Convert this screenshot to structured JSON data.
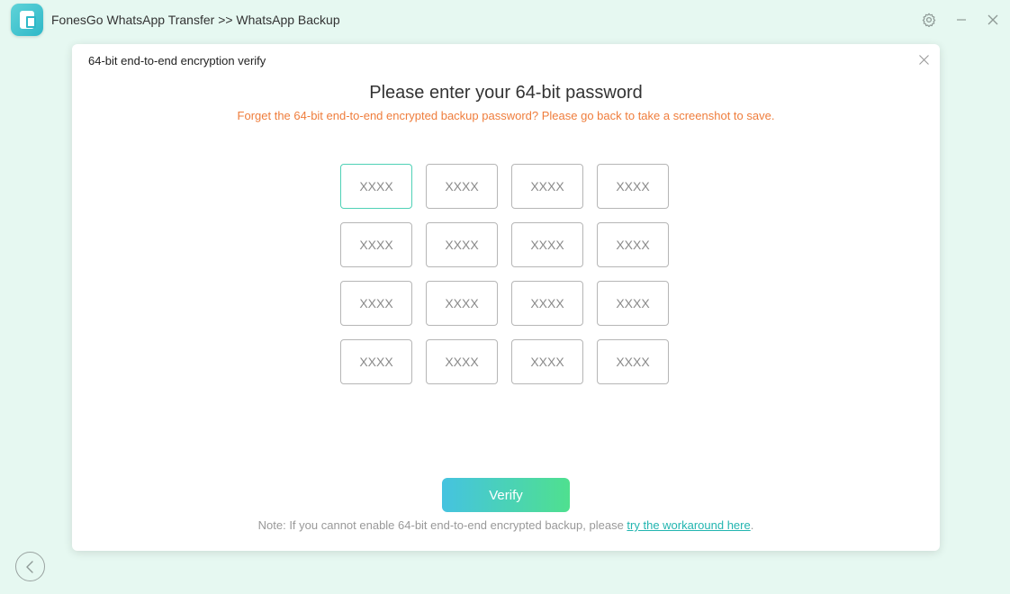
{
  "app": {
    "title": "FonesGo WhatsApp Transfer >> WhatsApp Backup",
    "icon": "app-logo-icon"
  },
  "window_controls": {
    "settings_icon": "gear-icon",
    "minimize_icon": "minimize-icon",
    "close_icon": "close-icon"
  },
  "dialog": {
    "title": "64-bit end-to-end encryption verify",
    "heading": "Please enter your 64-bit password",
    "subheading": "Forget the 64-bit end-to-end encrypted backup password? Please go back to take a screenshot to save.",
    "inputs": [
      {
        "placeholder": "XXXX",
        "value": ""
      },
      {
        "placeholder": "XXXX",
        "value": ""
      },
      {
        "placeholder": "XXXX",
        "value": ""
      },
      {
        "placeholder": "XXXX",
        "value": ""
      },
      {
        "placeholder": "XXXX",
        "value": ""
      },
      {
        "placeholder": "XXXX",
        "value": ""
      },
      {
        "placeholder": "XXXX",
        "value": ""
      },
      {
        "placeholder": "XXXX",
        "value": ""
      },
      {
        "placeholder": "XXXX",
        "value": ""
      },
      {
        "placeholder": "XXXX",
        "value": ""
      },
      {
        "placeholder": "XXXX",
        "value": ""
      },
      {
        "placeholder": "XXXX",
        "value": ""
      },
      {
        "placeholder": "XXXX",
        "value": ""
      },
      {
        "placeholder": "XXXX",
        "value": ""
      },
      {
        "placeholder": "XXXX",
        "value": ""
      },
      {
        "placeholder": "XXXX",
        "value": ""
      }
    ],
    "verify_label": "Verify",
    "note_text": "Note: If you cannot enable 64-bit end-to-end encrypted backup, please ",
    "note_link": "try the workaround here",
    "note_end": "."
  },
  "colors": {
    "background": "#e6f8f1",
    "accent_orange": "#ef7d3c",
    "link": "#22b5b0",
    "button_gradient_start": "#45c3e0",
    "button_gradient_end": "#4fe08f",
    "focus_border": "#4fd1b6"
  },
  "back_icon": "chevron-left-icon"
}
